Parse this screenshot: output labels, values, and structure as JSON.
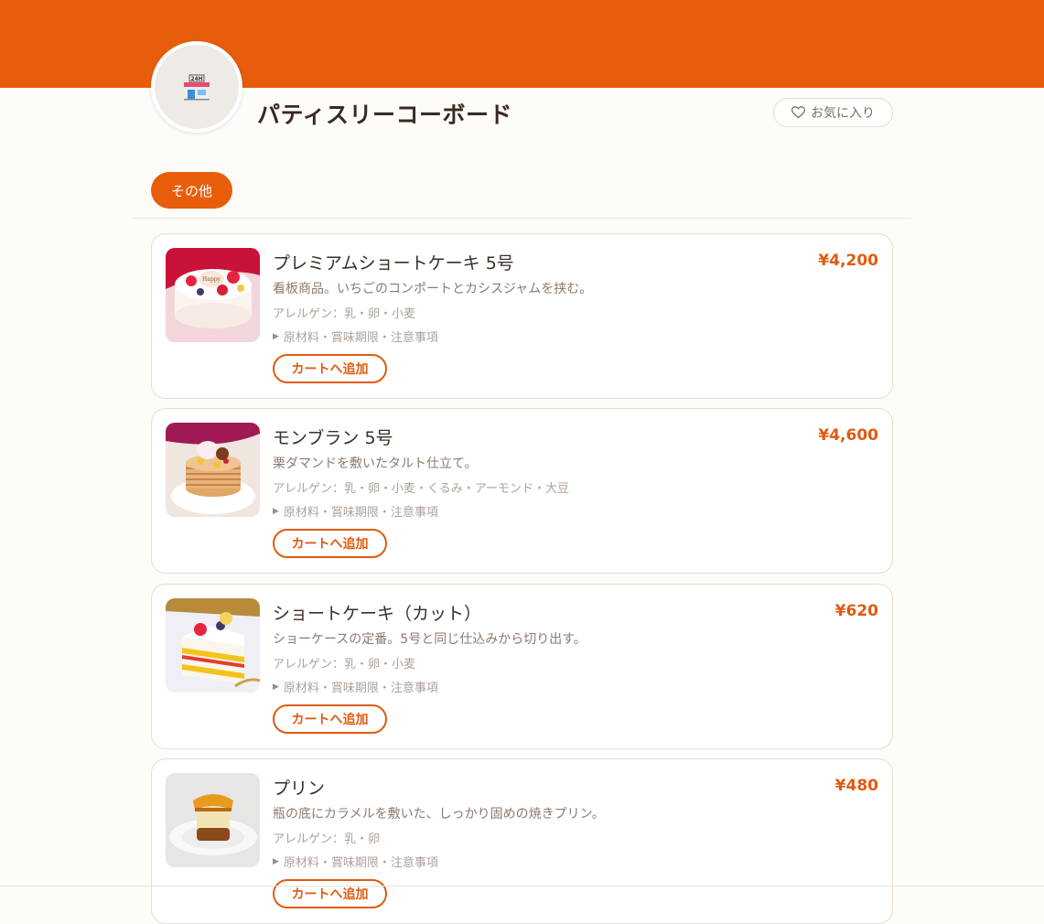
{
  "shop": {
    "name": "パティスリーコーボード",
    "favorite_label": "お気に入り",
    "brand_color": "#e85d0c",
    "avatar_icon": "convenience-store-24h-icon"
  },
  "categories": [
    {
      "label": "その他",
      "active": true
    }
  ],
  "items": [
    {
      "name": "プレミアムショートケーキ 5号",
      "price": "¥4,200",
      "description": "看板商品。いちごのコンポートとカシスジャムを挟む。",
      "allergens": "アレルゲン：乳・卵・小麦",
      "details_label": "原材料・賞味期限・注意事項",
      "add_label": "カートへ追加"
    },
    {
      "name": "モンブラン 5号",
      "price": "¥4,600",
      "description": "栗ダマンドを敷いたタルト仕立て。",
      "allergens": "アレルゲン：乳・卵・小麦・くるみ・アーモンド・大豆",
      "details_label": "原材料・賞味期限・注意事項",
      "add_label": "カートへ追加"
    },
    {
      "name": "ショートケーキ（カット）",
      "price": "¥620",
      "description": "ショーケースの定番。5号と同じ仕込みから切り出す。",
      "allergens": "アレルゲン：乳・卵・小麦",
      "details_label": "原材料・賞味期限・注意事項",
      "add_label": "カートへ追加"
    },
    {
      "name": "プリン",
      "price": "¥480",
      "description": "瓶の底にカラメルを敷いた、しっかり固めの焼きプリン。",
      "allergens": "アレルゲン：乳・卵",
      "details_label": "原材料・賞味期限・注意事項",
      "add_label": "カートへ追加"
    }
  ]
}
